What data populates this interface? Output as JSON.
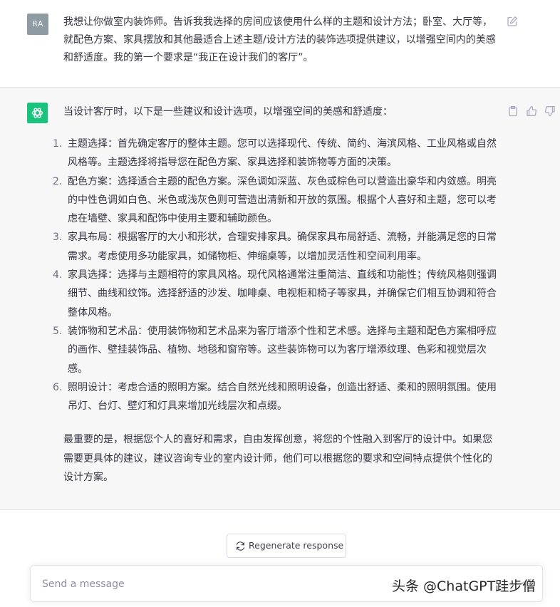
{
  "user": {
    "avatar_initials": "RA",
    "message": "我想让你做室内装饰师。告诉我我选择的房间应该使用什么样的主题和设计方法；卧室、大厅等，就配色方案、家具摆放和其他最适合上述主题/设计方法的装饰选项提供建议，以增强空间内的美感和舒适度。我的第一个要求是“我正在设计我们的客厅”。"
  },
  "assistant": {
    "intro": "当设计客厅时，以下是一些建议和设计选项，以增强空间的美感和舒适度：",
    "items": [
      {
        "num": "1.",
        "text": "主题选择：首先确定客厅的整体主题。您可以选择现代、传统、简约、海滨风格、工业风格或自然风格等。主题选择将指导您在配色方案、家具选择和装饰物等方面的决策。"
      },
      {
        "num": "2.",
        "text": "配色方案：选择适合主题的配色方案。深色调如深蓝、灰色或棕色可以营造出豪华和内敛感。明亮的中性色调如白色、米色或浅灰色则可营造出清新和开放的氛围。根据个人喜好和主题，您可以考虑在墙壁、家具和配饰中使用主要和辅助颜色。"
      },
      {
        "num": "3.",
        "text": "家具布局：根据客厅的大小和形状，合理安排家具。确保家具布局舒适、流畅，并能满足您的日常需求。考虑使用多功能家具，如储物柜、伸缩桌等，以增加灵活性和空间利用率。"
      },
      {
        "num": "4.",
        "text": "家具选择：选择与主题相符的家具风格。现代风格通常注重简洁、直线和功能性；传统风格则强调细节、曲线和纹饰。选择舒适的沙发、咖啡桌、电视柜和椅子等家具，并确保它们相互协调和符合整体风格。"
      },
      {
        "num": "5.",
        "text": "装饰物和艺术品：使用装饰物和艺术品来为客厅增添个性和艺术感。选择与主题和配色方案相呼应的画作、壁挂装饰品、植物、地毯和窗帘等。这些装饰物可以为客厅增添纹理、色彩和视觉层次感。"
      },
      {
        "num": "6.",
        "text": "照明设计：考虑合适的照明方案。结合自然光线和照明设备，创造出舒适、柔和的照明氛围。使用吊灯、台灯、壁灯和灯具来增加光线层次和点缀。"
      }
    ],
    "conclusion": "最重要的是，根据您个人的喜好和需求，自由发挥创意，将您的个性融入到客厅的设计中。如果您需要更具体的建议，建议咨询专业的室内设计师，他们可以根据您的要求和空间特点提供个性化的设计方案。"
  },
  "regenerate_label": "Regenerate response",
  "input": {
    "placeholder": "Send a message"
  },
  "watermark": "头条 @ChatGPT跬步僧",
  "colors": {
    "brand_green": "#19c37d",
    "user_avatar": "#8e9ba3",
    "assistant_bg": "#f7f7f8"
  },
  "icons": {
    "edit": "edit-icon",
    "copy": "clipboard-icon",
    "like": "thumbs-up-icon",
    "dislike": "thumbs-down-icon",
    "regenerate": "refresh-icon",
    "send": "send-icon"
  }
}
